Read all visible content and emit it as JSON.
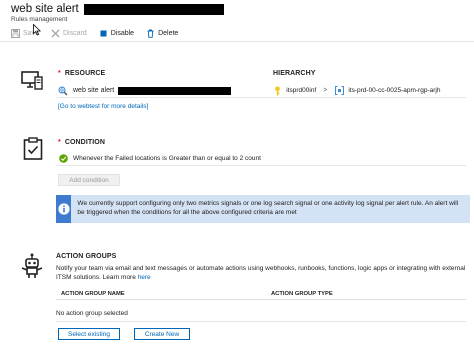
{
  "header": {
    "title": "web site alert",
    "subtitle": "Rules management"
  },
  "toolbar": {
    "save": "Save",
    "discard": "Discard",
    "disable": "Disable",
    "delete": "Delete"
  },
  "resource": {
    "section_title": "RESOURCE",
    "hierarchy_label": "HIERARCHY",
    "name": "web site alert",
    "hierarchy_1": "itsprd00inf",
    "hierarchy_2": "its-prd-00-cc-0025-apm-rgp-arjh",
    "webtest_link": "[Go to webtest for more details]"
  },
  "condition": {
    "section_title": "CONDITION",
    "text": "Whenever the Failed locations is Greater than or equal to 2 count",
    "add_button": "Add condition",
    "info": "We currently support configuring only two metrics signals or one log search signal or one activity log signal per alert rule. An alert will be triggered when the conditions for all the above configured criteria are met"
  },
  "action_groups": {
    "section_title": "ACTION GROUPS",
    "description": "Notify your team via email and text messages or automate actions using webhooks, runbooks, functions, logic apps or integrating with external ITSM solutions. Learn more",
    "learn_more_link": "here",
    "col_name": "ACTION GROUP NAME",
    "col_type": "ACTION GROUP TYPE",
    "empty_text": "No action group selected",
    "select_button": "Select existing",
    "create_button": "Create New"
  },
  "colors": {
    "accent": "#0067b8",
    "required": "#e81123",
    "success": "#57a300",
    "info_bg": "#d4e2f5"
  }
}
